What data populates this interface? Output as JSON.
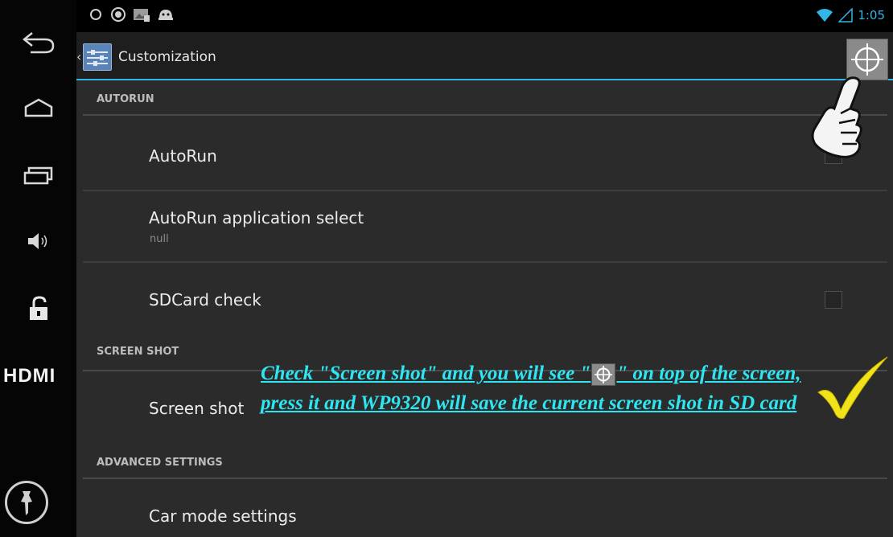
{
  "colors": {
    "background": "#2b2b2b",
    "holo_blue": "#33b5e5",
    "annotation": "#2ee6f2",
    "checkmark": "#f2e21a"
  },
  "navbar": {
    "icons": [
      "back-icon",
      "home-icon",
      "recents-icon",
      "volume-icon",
      "unlock-icon",
      "pin-icon"
    ],
    "hdmi_label": "HDMI"
  },
  "status_bar": {
    "left_icons": [
      "ring-icon",
      "circle-a-icon",
      "gallery-icon",
      "android-icon"
    ],
    "time": "1:05"
  },
  "action_bar": {
    "title": "Customization",
    "screenshot_icon": "crosshair-icon"
  },
  "sections": {
    "autorun": {
      "header": "AUTORUN",
      "items": [
        {
          "title": "AutoRun"
        },
        {
          "title": "AutoRun application select",
          "subtitle": "null"
        },
        {
          "title": "SDCard check"
        }
      ]
    },
    "screen_shot": {
      "header": "SCREEN SHOT",
      "items": [
        {
          "title": "Screen shot"
        }
      ]
    },
    "advanced": {
      "header": "ADVANCED SETTINGS",
      "items": [
        {
          "title": "Car mode settings"
        }
      ]
    }
  },
  "annotation": {
    "part1": "Check \"Screen shot\" and you will see \"",
    "part2": "\" on top of the screen, press it and WP9320 will save the current screen shot in SD card"
  }
}
